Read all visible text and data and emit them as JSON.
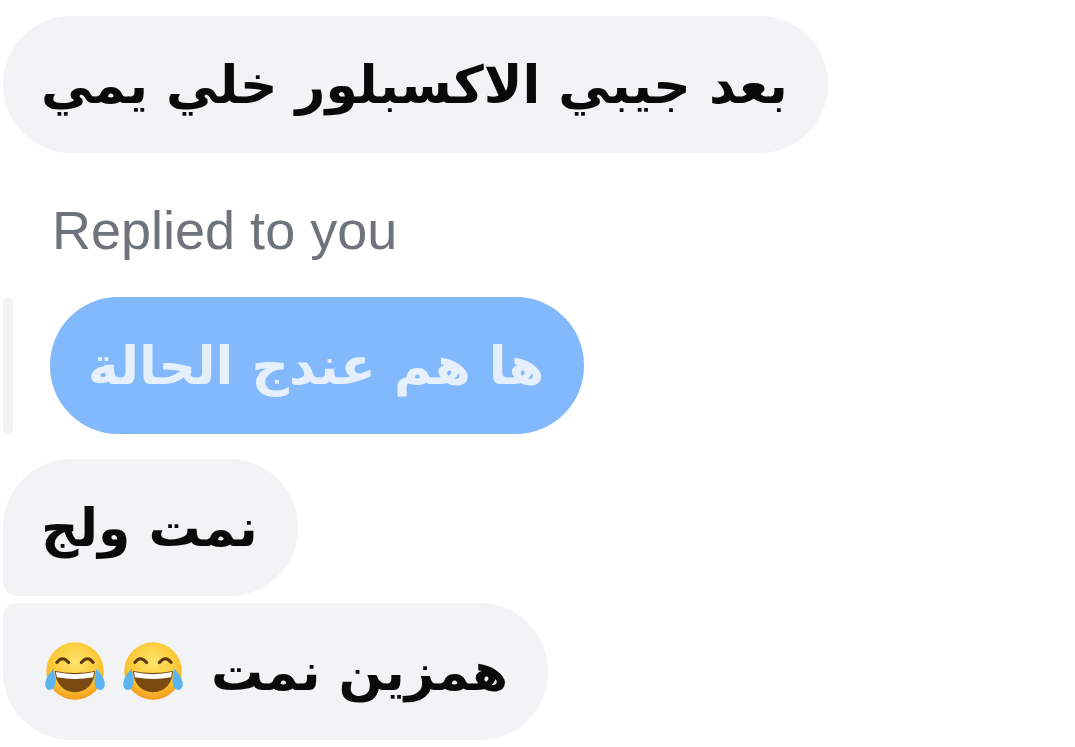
{
  "messages": [
    {
      "kind": "received",
      "text": "بعد جيبي الاكسبلور خلي يمي"
    },
    {
      "kind": "reply_label",
      "text": "Replied to you"
    },
    {
      "kind": "quoted",
      "text": "ها هم عندج الحالة"
    },
    {
      "kind": "received",
      "text": "نمت ولج"
    },
    {
      "kind": "received",
      "text": "همزين نمت",
      "emojis": [
        {
          "kind": "tears-of-joy"
        },
        {
          "kind": "tears-of-joy"
        }
      ]
    }
  ]
}
